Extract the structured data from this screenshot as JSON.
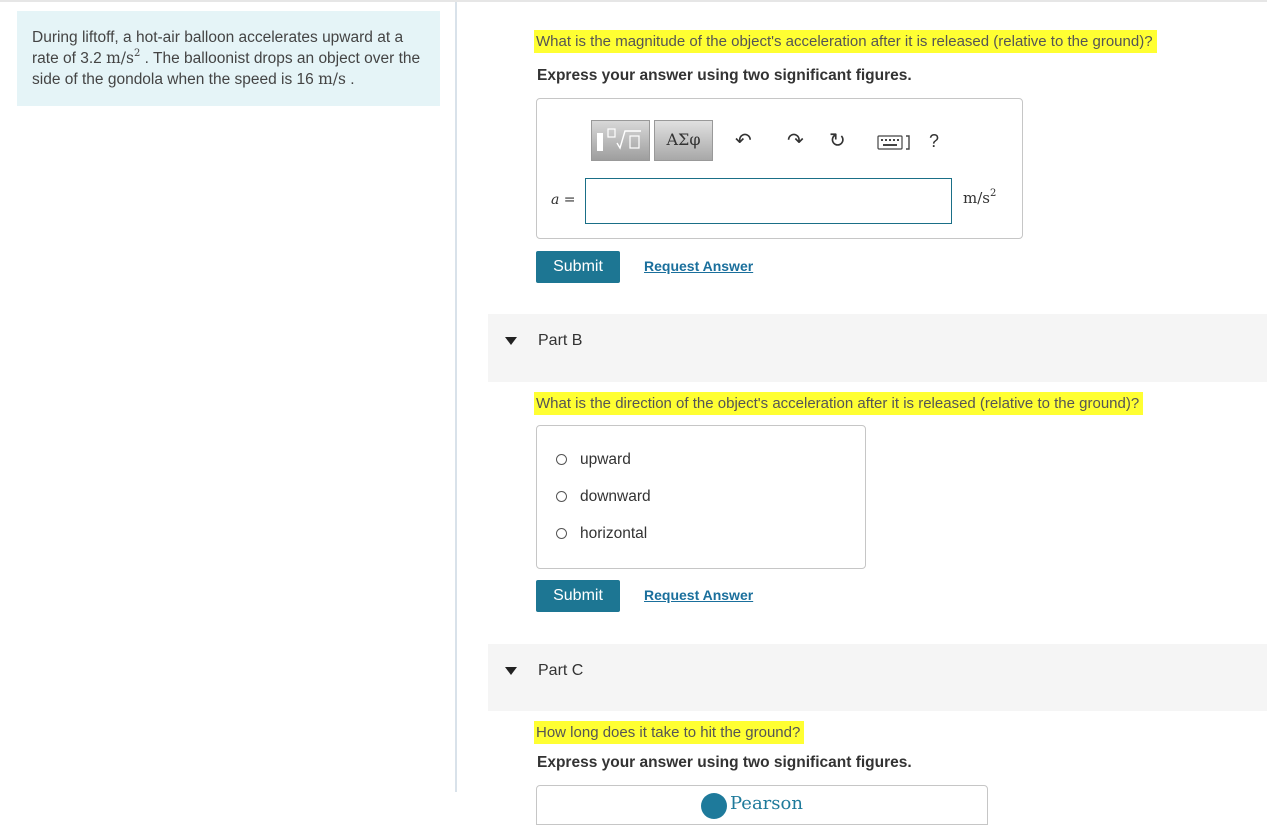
{
  "problem": {
    "text_1": "During liftoff, a hot-air balloon accelerates upward at a rate of 3.2",
    "unit_1_base": "m/s",
    "unit_1_exp": "2",
    "text_2": ". The balloonist drops an object over the side of the gondola when the speed is 16",
    "unit_2": "m/s",
    "text_3": "."
  },
  "part_a": {
    "question": "What is the magnitude of the object's acceleration after it is released (relative to the ground)?",
    "instruction": "Express your answer using two significant figures.",
    "toolbar": {
      "templates_icon": "templates-icon",
      "symbols_label": "ΑΣφ",
      "undo_icon": "undo-icon",
      "redo_icon": "redo-icon",
      "reset_icon": "reset-icon",
      "keyboard_icon": "keyboard-icon",
      "help_label": "?"
    },
    "variable_label": "a =",
    "input_value": "",
    "unit_base": "m/s",
    "unit_exp": "2",
    "submit_label": "Submit",
    "request_label": "Request Answer"
  },
  "part_b": {
    "title": "Part B",
    "question": "What is the direction of the object's acceleration after it is released (relative to the ground)?",
    "options": [
      "upward",
      "downward",
      "horizontal"
    ],
    "submit_label": "Submit",
    "request_label": "Request Answer"
  },
  "part_c": {
    "title": "Part C",
    "question": "How long does it take to hit the ground?",
    "instruction": "Express your answer using two significant figures."
  },
  "footer": {
    "brand_icon": "pearson-logo-icon",
    "brand_name": "Pearson"
  },
  "colors": {
    "highlight": "#ffff32",
    "accent": "#1d7693",
    "intro_bg": "#e5f4f7",
    "link": "#1a6f9c"
  }
}
